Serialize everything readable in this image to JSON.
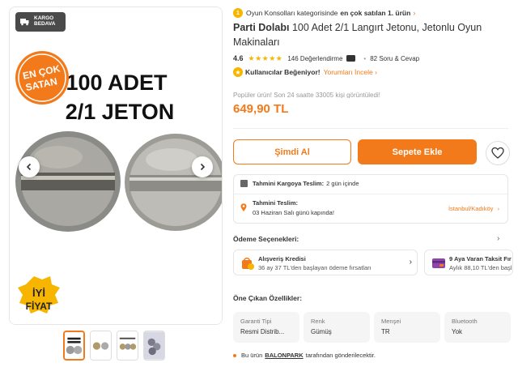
{
  "gallery": {
    "cargo_badge": "KARGO\nBEDAVA",
    "cargo_line1": "KARGO",
    "cargo_line2": "BEDAVA",
    "image_text_line1": "100 ADET",
    "image_text_line2": "2/1 JETON",
    "sticker_top_1": "EN ÇOK",
    "sticker_top_2": "SATAN",
    "sticker_bottom_1": "İYİ",
    "sticker_bottom_2": "FİYAT",
    "thumbnails": 4,
    "active_thumbnail": 1
  },
  "best_seller": {
    "medal": "1",
    "text": "Oyun Konsolları kategorisinde",
    "bold": "en çok satılan 1. ürün"
  },
  "product": {
    "brand": "Parti Dolabı",
    "name": "100 Adet 2/1 Langırt Jetonu, Jetonlu Oyun Makinaları",
    "rating": "4.6",
    "reviews": "146 Değerlendirme",
    "qa": "82 Soru & Cevap",
    "liked_bold": "Kullanıcılar Beğeniyor!",
    "liked_link": "Yorumları İncele",
    "faded_notice": "Popüler ürün! Son 24 saatte 33005 kişi görüntüledi!",
    "price": "649,90 TL"
  },
  "actions": {
    "buy_now": "Şimdi Al",
    "add_to_cart": "Sepete Ekle"
  },
  "delivery": {
    "cargo_label": "Tahmini Kargoya Teslim:",
    "cargo_value": "2 gün içinde",
    "delivery_label": "Tahmini Teslim:",
    "delivery_value": "03 Haziran Salı günü kapında!",
    "location": "İstanbul/Kadıköy"
  },
  "payment": {
    "title": "Ödeme Seçenekleri:",
    "card1_title": "Alışveriş Kredisi",
    "card1_desc": "36 ay 37 TL'den başlayan ödeme fırsatları",
    "card2_title": "9 Aya Varan Taksit Fır",
    "card2_desc": "Aylık 88,10 TL'den başl"
  },
  "features": {
    "title": "Öne Çıkan Özellikler:",
    "items": [
      {
        "key": "Garanti Tipi",
        "value": "Resmi Distrib..."
      },
      {
        "key": "Renk",
        "value": "Gümüş"
      },
      {
        "key": "Menşei",
        "value": "TR"
      },
      {
        "key": "Bluetooth",
        "value": "Yok"
      }
    ]
  },
  "seller": {
    "prefix": "Bu ürün",
    "name": "BALONPARK",
    "suffix": "tarafından gönderilecektir."
  },
  "colors": {
    "accent": "#f27a1a",
    "star": "#f7b500"
  }
}
